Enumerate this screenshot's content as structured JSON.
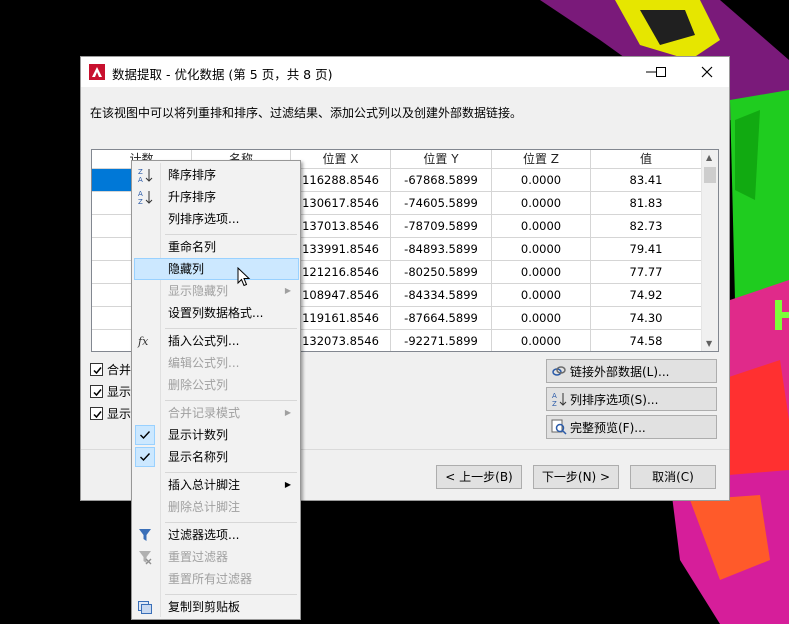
{
  "dialog": {
    "title": "数据提取 - 优化数据 (第 5 页，共 8 页)",
    "description": "在该视图中可以将列重排和排序、过滤结果、添加公式列以及创建外部数据链接。"
  },
  "grid": {
    "columns": [
      "计数",
      "名称",
      "位置 X",
      "位置 Y",
      "位置 Z",
      "值"
    ],
    "rows": [
      [
        "",
        "",
        "116288.8546",
        "-67868.5899",
        "0.0000",
        "83.41"
      ],
      [
        "",
        "",
        "130617.8546",
        "-74605.5899",
        "0.0000",
        "81.83"
      ],
      [
        "",
        "",
        "137013.8546",
        "-78709.5899",
        "0.0000",
        "82.73"
      ],
      [
        "",
        "",
        "133991.8546",
        "-84893.5899",
        "0.0000",
        "79.41"
      ],
      [
        "",
        "",
        "121216.8546",
        "-80250.5899",
        "0.0000",
        "77.77"
      ],
      [
        "",
        "",
        "108947.8546",
        "-84334.5899",
        "0.0000",
        "74.92"
      ],
      [
        "",
        "",
        "119161.8546",
        "-87664.5899",
        "0.0000",
        "74.30"
      ],
      [
        "",
        "",
        "132073.8546",
        "-92271.5899",
        "0.0000",
        "74.58"
      ]
    ]
  },
  "options": [
    {
      "label": "合并",
      "checked": true
    },
    {
      "label": "显示",
      "checked": true
    },
    {
      "label": "显示",
      "checked": true
    }
  ],
  "side_buttons": {
    "link": "链接外部数据(L)...",
    "sort": "列排序选项(S)...",
    "preview": "完整预览(F)..."
  },
  "footer": {
    "back": "< 上一步(B)",
    "next": "下一步(N) >",
    "cancel": "取消(C)"
  },
  "menu": {
    "sort_desc": "降序排序",
    "sort_asc": "升序排序",
    "sort_options": "列排序选项...",
    "rename": "重命名列",
    "hide": "隐藏列",
    "show_hidden": "显示隐藏列",
    "format": "设置列数据格式...",
    "insert_formula": "插入公式列...",
    "edit_formula": "编辑公式列...",
    "delete_formula": "删除公式列",
    "merge_mode": "合并记录模式",
    "show_count": "显示计数列",
    "show_name": "显示名称列",
    "insert_footer": "插入总计脚注",
    "delete_footer": "删除总计脚注",
    "filter_options": "过滤器选项...",
    "reset_filter": "重置过滤器",
    "reset_all_filters": "重置所有过滤器",
    "copy_clipboard": "复制到剪贴板"
  },
  "colors": {
    "selection": "#0078d7",
    "menu_hover": "#cce8ff"
  }
}
